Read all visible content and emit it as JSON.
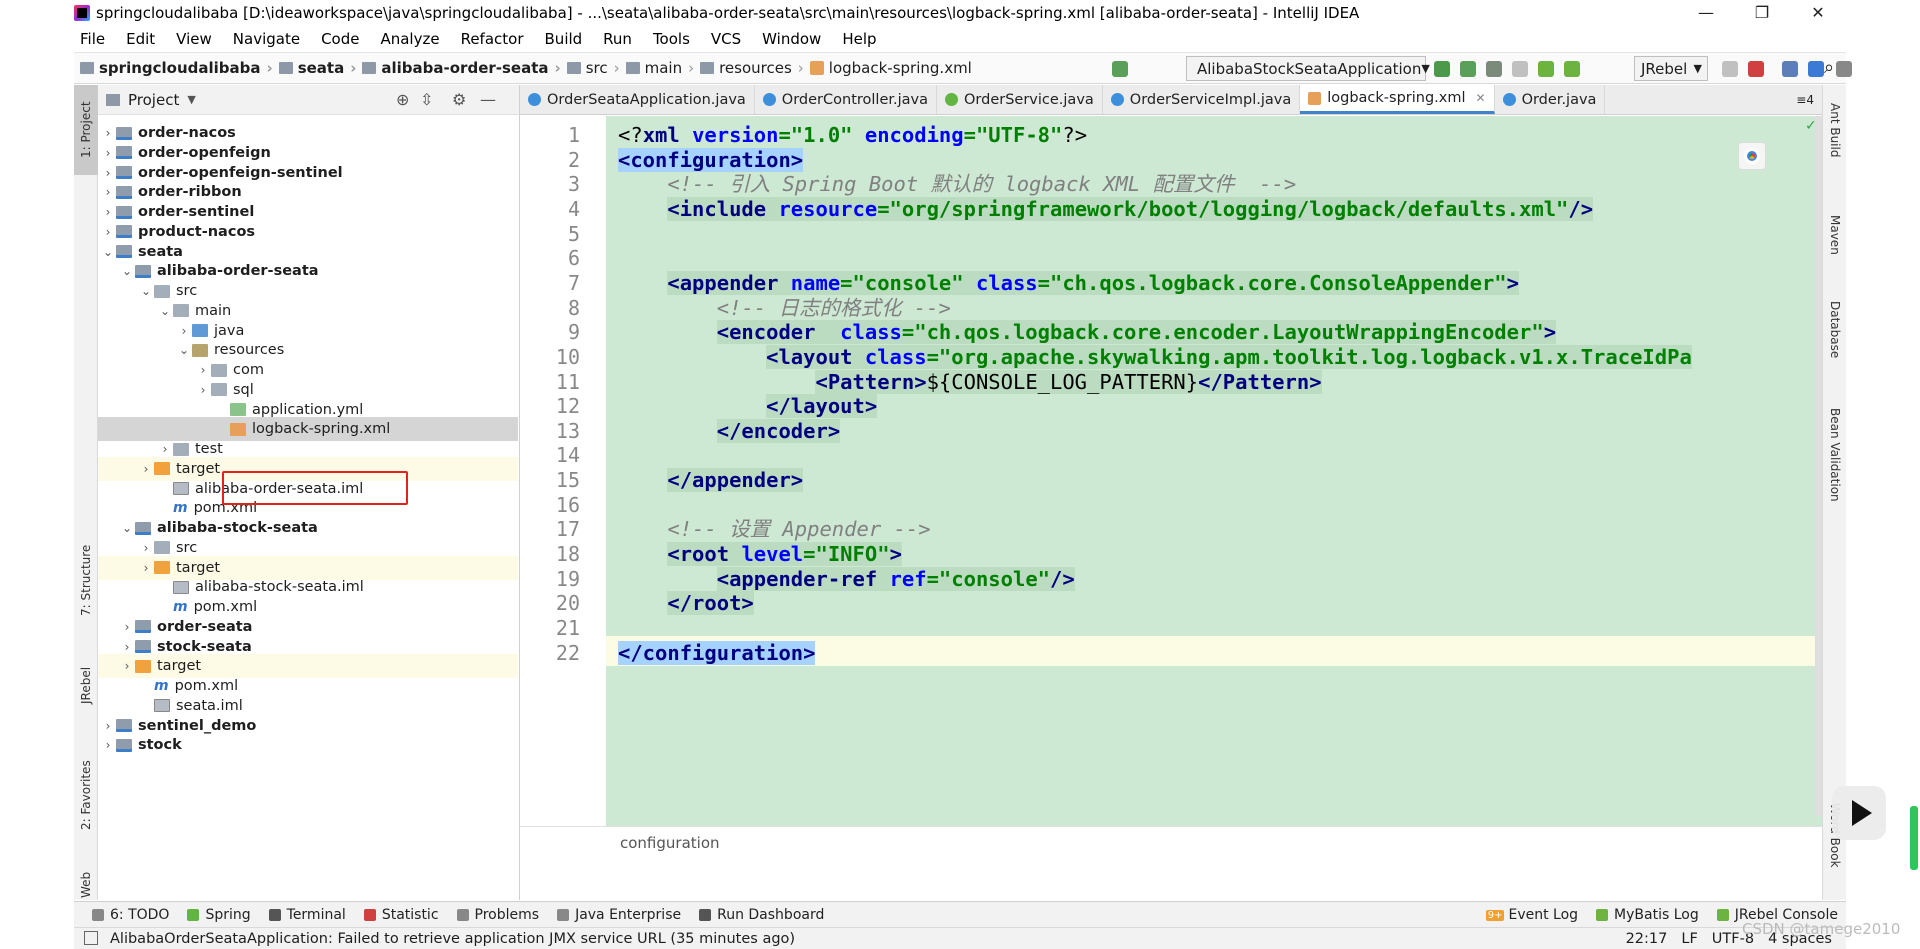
{
  "window": {
    "title": "springcloudalibaba [D:\\ideaworkspace\\java\\springcloudalibaba] - ...\\seata\\alibaba-order-seata\\src\\main\\resources\\logback-spring.xml [alibaba-order-seata] - IntelliJ IDEA",
    "minimize": "—",
    "restore": "❐",
    "close": "✕"
  },
  "menu": [
    "File",
    "Edit",
    "View",
    "Navigate",
    "Code",
    "Analyze",
    "Refactor",
    "Build",
    "Run",
    "Tools",
    "VCS",
    "Window",
    "Help"
  ],
  "breadcrumb": [
    "springcloudalibaba",
    "seata",
    "alibaba-order-seata",
    "src",
    "main",
    "resources",
    "logback-spring.xml"
  ],
  "toolbar": {
    "run_config": "AlibabaStockSeataApplication",
    "jrebel": "JRebel"
  },
  "project_panel": {
    "title": "Project",
    "rows": [
      {
        "label": "order-nacos",
        "depth": 0,
        "arrow": "›",
        "icon": "module",
        "bold": true
      },
      {
        "label": "order-openfeign",
        "depth": 0,
        "arrow": "›",
        "icon": "module",
        "bold": true
      },
      {
        "label": "order-openfeign-sentinel",
        "depth": 0,
        "arrow": "›",
        "icon": "module",
        "bold": true
      },
      {
        "label": "order-ribbon",
        "depth": 0,
        "arrow": "›",
        "icon": "module",
        "bold": true
      },
      {
        "label": "order-sentinel",
        "depth": 0,
        "arrow": "›",
        "icon": "module",
        "bold": true
      },
      {
        "label": "product-nacos",
        "depth": 0,
        "arrow": "›",
        "icon": "module",
        "bold": true
      },
      {
        "label": "seata",
        "depth": 0,
        "arrow": "⌄",
        "icon": "module",
        "bold": true
      },
      {
        "label": "alibaba-order-seata",
        "depth": 1,
        "arrow": "⌄",
        "icon": "module",
        "bold": true
      },
      {
        "label": "src",
        "depth": 2,
        "arrow": "⌄",
        "icon": "folder",
        "bold": false
      },
      {
        "label": "main",
        "depth": 3,
        "arrow": "⌄",
        "icon": "folder",
        "bold": false
      },
      {
        "label": "java",
        "depth": 4,
        "arrow": "›",
        "icon": "srcfolder",
        "bold": false
      },
      {
        "label": "resources",
        "depth": 4,
        "arrow": "⌄",
        "icon": "resfolder",
        "bold": false
      },
      {
        "label": "com",
        "depth": 5,
        "arrow": "›",
        "icon": "folder",
        "bold": false
      },
      {
        "label": "sql",
        "depth": 5,
        "arrow": "›",
        "icon": "folder",
        "bold": false
      },
      {
        "label": "application.yml",
        "depth": 6,
        "arrow": "",
        "icon": "yml",
        "bold": false
      },
      {
        "label": "logback-spring.xml",
        "depth": 6,
        "arrow": "",
        "icon": "xml",
        "bold": false,
        "selected": true
      },
      {
        "label": "test",
        "depth": 3,
        "arrow": "›",
        "icon": "folder",
        "bold": false
      },
      {
        "label": "target",
        "depth": 2,
        "arrow": "›",
        "icon": "orange",
        "bold": false,
        "highlight": true
      },
      {
        "label": "alibaba-order-seata.iml",
        "depth": 3,
        "arrow": "",
        "icon": "iml",
        "bold": false
      },
      {
        "label": "pom.xml",
        "depth": 3,
        "arrow": "",
        "icon": "maven",
        "bold": false
      },
      {
        "label": "alibaba-stock-seata",
        "depth": 1,
        "arrow": "⌄",
        "icon": "module",
        "bold": true
      },
      {
        "label": "src",
        "depth": 2,
        "arrow": "›",
        "icon": "folder",
        "bold": false
      },
      {
        "label": "target",
        "depth": 2,
        "arrow": "›",
        "icon": "orange",
        "bold": false,
        "highlight": true
      },
      {
        "label": "alibaba-stock-seata.iml",
        "depth": 3,
        "arrow": "",
        "icon": "iml",
        "bold": false
      },
      {
        "label": "pom.xml",
        "depth": 3,
        "arrow": "",
        "icon": "maven",
        "bold": false
      },
      {
        "label": "order-seata",
        "depth": 1,
        "arrow": "›",
        "icon": "module",
        "bold": true
      },
      {
        "label": "stock-seata",
        "depth": 1,
        "arrow": "›",
        "icon": "module",
        "bold": true
      },
      {
        "label": "target",
        "depth": 1,
        "arrow": "›",
        "icon": "orange",
        "bold": false,
        "highlight": true
      },
      {
        "label": "pom.xml",
        "depth": 2,
        "arrow": "",
        "icon": "maven",
        "bold": false
      },
      {
        "label": "seata.iml",
        "depth": 2,
        "arrow": "",
        "icon": "iml",
        "bold": false
      },
      {
        "label": "sentinel_demo",
        "depth": 0,
        "arrow": "›",
        "icon": "module",
        "bold": true
      },
      {
        "label": "stock",
        "depth": 0,
        "arrow": "›",
        "icon": "module",
        "bold": true
      }
    ]
  },
  "editor_tabs": [
    {
      "label": "OrderSeataApplication.java",
      "icon": "class-icon",
      "color": "#3d8fdc",
      "active": false
    },
    {
      "label": "OrderController.java",
      "icon": "class-icon",
      "color": "#3d8fdc",
      "active": false
    },
    {
      "label": "OrderService.java",
      "icon": "interface-icon",
      "color": "#62b543",
      "active": false
    },
    {
      "label": "OrderServiceImpl.java",
      "icon": "class-icon",
      "color": "#3d8fdc",
      "active": false
    },
    {
      "label": "logback-spring.xml",
      "icon": "xml-icon",
      "color": "#e6a05a",
      "active": true
    },
    {
      "label": "Order.java",
      "icon": "class-icon",
      "color": "#3d8fdc",
      "active": false
    }
  ],
  "tab_overflow": "≡4",
  "editor": {
    "breadcrumb": "configuration",
    "lines": [
      {
        "n": "1",
        "html": "<span class=\"p\">&lt;?</span><span class=\"t\">xml </span><span class=\"a\">version</span><span class=\"v\">=\"1.0\" </span><span class=\"a\">encoding</span><span class=\"v\">=\"UTF-8\"</span><span class=\"p\">?&gt;</span>"
      },
      {
        "n": "2",
        "html": "<span class=\"tsel\"><span class=\"t\">&lt;configuration&gt;</span></span>"
      },
      {
        "n": "3",
        "html": "    <span class=\"c\">&lt;!-- 引入 Spring Boot 默认的 logback XML 配置文件  --&gt;</span>"
      },
      {
        "n": "4",
        "html": "    <span class=\"tb\"><span class=\"t\">&lt;include </span><span class=\"a\">resource</span><span class=\"v\">=\"org/springframework/boot/logging/logback/defaults.xml\"</span><span class=\"t\">/&gt;</span></span>"
      },
      {
        "n": "5",
        "html": ""
      },
      {
        "n": "6",
        "html": ""
      },
      {
        "n": "7",
        "html": "    <span class=\"tb\"><span class=\"t\">&lt;appender </span><span class=\"a\">name</span><span class=\"v\">=\"console\" </span><span class=\"a\">class</span><span class=\"v\">=\"ch.qos.logback.core.ConsoleAppender\"</span><span class=\"t\">&gt;</span></span>"
      },
      {
        "n": "8",
        "html": "        <span class=\"c\">&lt;!-- 日志的格式化 --&gt;</span>"
      },
      {
        "n": "9",
        "html": "        <span class=\"tb\"><span class=\"t\">&lt;encoder  </span><span class=\"a\">class</span><span class=\"v\">=\"ch.qos.logback.core.encoder.LayoutWrappingEncoder\"</span><span class=\"t\">&gt;</span></span>"
      },
      {
        "n": "10",
        "html": "            <span class=\"tb\"><span class=\"t\">&lt;layout </span><span class=\"a\">class</span><span class=\"v\">=\"org.apache.skywalking.apm.toolkit.log.logback.v1.x.TraceIdPa</span></span>"
      },
      {
        "n": "11",
        "html": "                <span class=\"tb\"><span class=\"t\">&lt;Pattern&gt;</span><span class=\"p\">${CONSOLE_LOG_PATTERN}</span><span class=\"t\">&lt;/Pattern&gt;</span></span>"
      },
      {
        "n": "12",
        "html": "            <span class=\"tb\"><span class=\"t\">&lt;/layout&gt;</span></span>"
      },
      {
        "n": "13",
        "html": "        <span class=\"tb\"><span class=\"t\">&lt;/encoder&gt;</span></span>"
      },
      {
        "n": "14",
        "html": ""
      },
      {
        "n": "15",
        "html": "    <span class=\"tb\"><span class=\"t\">&lt;/appender&gt;</span></span>"
      },
      {
        "n": "16",
        "html": ""
      },
      {
        "n": "17",
        "html": "    <span class=\"c\">&lt;!-- 设置 Appender --&gt;</span>"
      },
      {
        "n": "18",
        "html": "    <span class=\"tb\"><span class=\"t\">&lt;root </span><span class=\"a\">level</span><span class=\"v\">=\"INFO\"</span><span class=\"t\">&gt;</span></span>"
      },
      {
        "n": "19",
        "html": "        <span class=\"tb\"><span class=\"t\">&lt;appender-ref </span><span class=\"a\">ref</span><span class=\"v\">=\"console\"</span><span class=\"t\">/&gt;</span></span>"
      },
      {
        "n": "20",
        "html": "    <span class=\"tb\"><span class=\"t\">&lt;/root&gt;</span></span>"
      },
      {
        "n": "21",
        "html": ""
      },
      {
        "n": "22",
        "html": "<span class=\"tsel\"><span class=\"t\">&lt;/configuration&gt;</span></span>"
      }
    ]
  },
  "left_strip": [
    "1: Project",
    "7: Structure",
    "JRebel",
    "2: Favorites",
    "Web"
  ],
  "right_strip": [
    "Ant Build",
    "Maven",
    "Database",
    "Bean Validation",
    "Word Book"
  ],
  "tool_windows": [
    {
      "label": "6: TODO",
      "color": "#888888"
    },
    {
      "label": "Spring",
      "color": "#62b543"
    },
    {
      "label": "Terminal",
      "color": "#555555"
    },
    {
      "label": "Statistic",
      "color": "#d04040"
    },
    {
      "label": "Problems",
      "color": "#888888"
    },
    {
      "label": "Java Enterprise",
      "color": "#888888"
    },
    {
      "label": "Run Dashboard",
      "color": "#555555"
    }
  ],
  "tool_windows_right": [
    {
      "label": "Event Log",
      "badge": "9+"
    },
    {
      "label": "MyBatis Log"
    },
    {
      "label": "JRebel Console"
    }
  ],
  "status": {
    "message": "AlibabaOrderSeataApplication: Failed to retrieve application JMX service URL (35 minutes ago)",
    "position": "22:17",
    "line_sep": "LF",
    "encoding": "UTF-8",
    "indent": "4 spaces"
  },
  "watermark": "CSDN @tamege2010"
}
